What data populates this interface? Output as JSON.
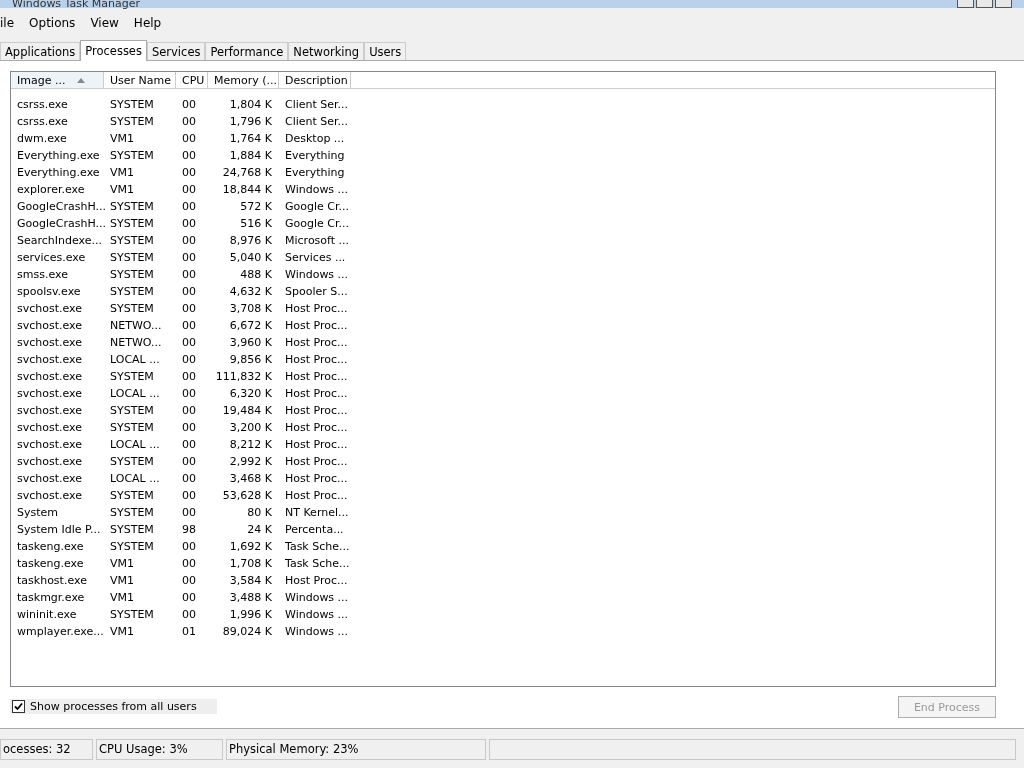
{
  "window": {
    "title": "Windows Task Manager"
  },
  "menu": [
    "ile",
    "Options",
    "View",
    "Help"
  ],
  "tabs": [
    {
      "label": "Applications",
      "selected": false
    },
    {
      "label": "Processes",
      "selected": true
    },
    {
      "label": "Services",
      "selected": false
    },
    {
      "label": "Performance",
      "selected": false
    },
    {
      "label": "Networking",
      "selected": false
    },
    {
      "label": "Users",
      "selected": false
    }
  ],
  "table": {
    "columns": [
      {
        "label": "Image ...",
        "sorted": true
      },
      {
        "label": "User Name",
        "sorted": false
      },
      {
        "label": "CPU",
        "sorted": false
      },
      {
        "label": "Memory (...",
        "sorted": false
      },
      {
        "label": "Description",
        "sorted": false
      }
    ],
    "rows": [
      [
        "csrss.exe",
        "SYSTEM",
        "00",
        "1,804 K",
        "Client Ser..."
      ],
      [
        "csrss.exe",
        "SYSTEM",
        "00",
        "1,796 K",
        "Client Ser..."
      ],
      [
        "dwm.exe",
        "VM1",
        "00",
        "1,764 K",
        "Desktop ..."
      ],
      [
        "Everything.exe",
        "SYSTEM",
        "00",
        "1,884 K",
        "Everything"
      ],
      [
        "Everything.exe",
        "VM1",
        "00",
        "24,768 K",
        "Everything"
      ],
      [
        "explorer.exe",
        "VM1",
        "00",
        "18,844 K",
        "Windows ..."
      ],
      [
        "GoogleCrashH...",
        "SYSTEM",
        "00",
        "572 K",
        "Google Cr..."
      ],
      [
        "GoogleCrashH...",
        "SYSTEM",
        "00",
        "516 K",
        "Google Cr..."
      ],
      [
        "SearchIndexe...",
        "SYSTEM",
        "00",
        "8,976 K",
        "Microsoft ..."
      ],
      [
        "services.exe",
        "SYSTEM",
        "00",
        "5,040 K",
        "Services ..."
      ],
      [
        "smss.exe",
        "SYSTEM",
        "00",
        "488 K",
        "Windows ..."
      ],
      [
        "spoolsv.exe",
        "SYSTEM",
        "00",
        "4,632 K",
        "Spooler S..."
      ],
      [
        "svchost.exe",
        "SYSTEM",
        "00",
        "3,708 K",
        "Host Proc..."
      ],
      [
        "svchost.exe",
        "NETWO...",
        "00",
        "6,672 K",
        "Host Proc..."
      ],
      [
        "svchost.exe",
        "NETWO...",
        "00",
        "3,960 K",
        "Host Proc..."
      ],
      [
        "svchost.exe",
        "LOCAL ...",
        "00",
        "9,856 K",
        "Host Proc..."
      ],
      [
        "svchost.exe",
        "SYSTEM",
        "00",
        "111,832 K",
        "Host Proc..."
      ],
      [
        "svchost.exe",
        "LOCAL ...",
        "00",
        "6,320 K",
        "Host Proc..."
      ],
      [
        "svchost.exe",
        "SYSTEM",
        "00",
        "19,484 K",
        "Host Proc..."
      ],
      [
        "svchost.exe",
        "SYSTEM",
        "00",
        "3,200 K",
        "Host Proc..."
      ],
      [
        "svchost.exe",
        "LOCAL ...",
        "00",
        "8,212 K",
        "Host Proc..."
      ],
      [
        "svchost.exe",
        "SYSTEM",
        "00",
        "2,992 K",
        "Host Proc..."
      ],
      [
        "svchost.exe",
        "LOCAL ...",
        "00",
        "3,468 K",
        "Host Proc..."
      ],
      [
        "svchost.exe",
        "SYSTEM",
        "00",
        "53,628 K",
        "Host Proc..."
      ],
      [
        "System",
        "SYSTEM",
        "00",
        "80 K",
        "NT Kernel..."
      ],
      [
        "System Idle P...",
        "SYSTEM",
        "98",
        "24 K",
        "Percenta..."
      ],
      [
        "taskeng.exe",
        "SYSTEM",
        "00",
        "1,692 K",
        "Task Sche..."
      ],
      [
        "taskeng.exe",
        "VM1",
        "00",
        "1,708 K",
        "Task Sche..."
      ],
      [
        "taskhost.exe",
        "VM1",
        "00",
        "3,584 K",
        "Host Proc..."
      ],
      [
        "taskmgr.exe",
        "VM1",
        "00",
        "3,488 K",
        "Windows ..."
      ],
      [
        "wininit.exe",
        "SYSTEM",
        "00",
        "1,996 K",
        "Windows ..."
      ],
      [
        "wmplayer.exe...",
        "VM1",
        "01",
        "89,024 K",
        "Windows ..."
      ]
    ]
  },
  "show_all_users": {
    "label": "Show processes from all users",
    "checked": true
  },
  "end_process": {
    "label": "End Process",
    "disabled": true
  },
  "status_bar": [
    "ocesses: 32",
    "CPU Usage: 3%",
    "Physical Memory: 23%"
  ]
}
